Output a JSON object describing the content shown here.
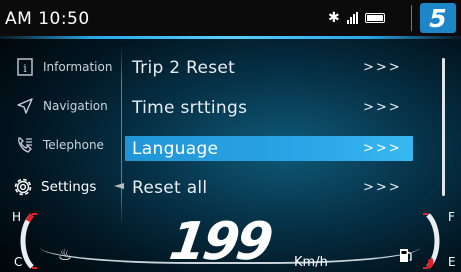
{
  "status_bar": {
    "time": "AM 10:50",
    "icons": [
      "bluetooth-icon",
      "signal-icon",
      "battery-icon"
    ],
    "logo_text": "5",
    "accent_color": "#1e86c8"
  },
  "sidebar": {
    "items": [
      {
        "label": "Information",
        "icon": "info-icon"
      },
      {
        "label": "Navigation",
        "icon": "navigation-icon"
      },
      {
        "label": "Telephone",
        "icon": "telephone-icon"
      },
      {
        "label": "Settings",
        "icon": "settings-icon",
        "active": true
      }
    ]
  },
  "menu": {
    "items": [
      {
        "label": "Trip 2 Reset",
        "arrows": ">>>"
      },
      {
        "label": "Time srttings",
        "arrows": ">>>"
      },
      {
        "label": "Language",
        "arrows": ">>>",
        "selected": true
      },
      {
        "label": "Reset all",
        "arrows": ">>>"
      }
    ],
    "highlight_color": "#2aa4e6"
  },
  "cluster": {
    "speed": "199",
    "speed_unit": "Km/h",
    "temp_gauge": {
      "high_label": "H",
      "low_label": "C"
    },
    "fuel_gauge": {
      "full_label": "F",
      "empty_label": "E"
    }
  }
}
